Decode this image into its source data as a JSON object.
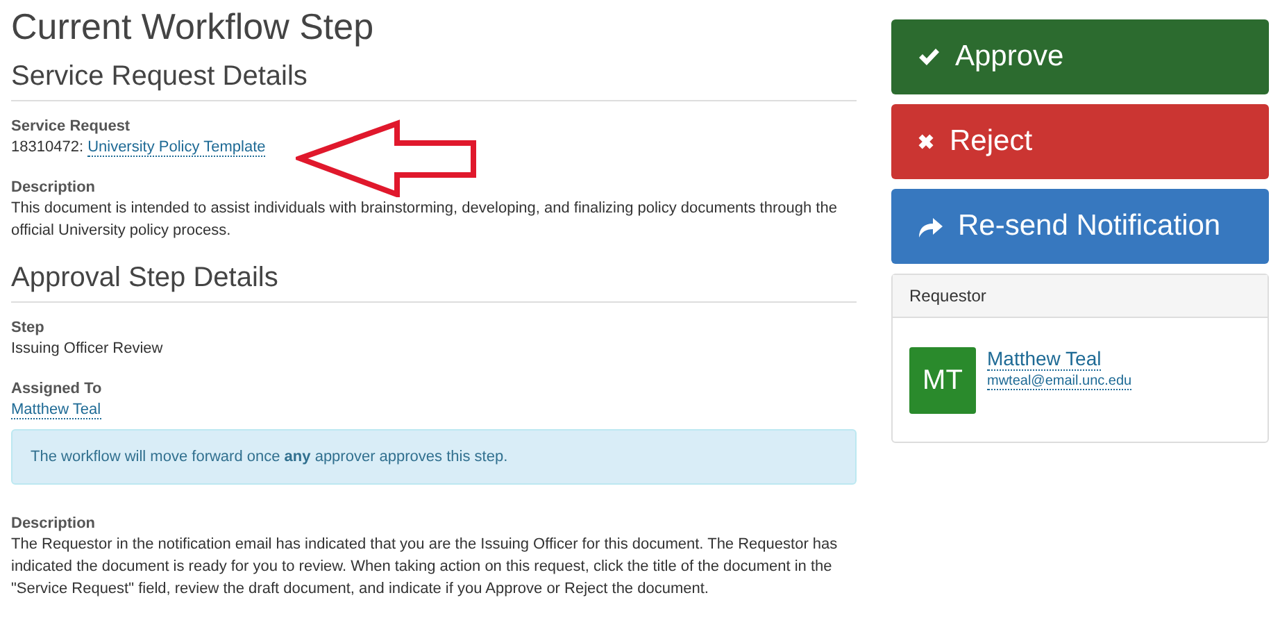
{
  "page_title": "Current Workflow Step",
  "service_request": {
    "heading": "Service Request Details",
    "request_label": "Service Request",
    "request_number": "18310472:",
    "request_link": "University Policy Template",
    "description_label": "Description",
    "description": "This document is intended to assist individuals with brainstorming, developing, and finalizing policy documents through the official University policy process."
  },
  "approval_step": {
    "heading": "Approval Step Details",
    "step_label": "Step",
    "step": "Issuing Officer Review",
    "assigned_label": "Assigned To",
    "assigned_link": "Matthew Teal",
    "alert": "The workflow will move forward once **any** approver approves this step.",
    "description_label": "Description",
    "description": "The Requestor in the notification email has indicated that you are the Issuing Officer for this document. The Requestor has indicated the document is ready for you to review. When taking action on this request, click the title of the document in the \"Service Request\" field, review the draft document, and indicate if you Approve or Reject the document."
  },
  "actions": [
    {
      "kind": "approve",
      "label": "Approve"
    },
    {
      "kind": "reject",
      "label": "Reject"
    },
    {
      "kind": "resend",
      "label": "Re-send Notification"
    }
  ],
  "requestor": {
    "heading": "Requestor",
    "initials": "MT",
    "name": "Matthew Teal",
    "email": "mwteal@email.unc.edu"
  }
}
